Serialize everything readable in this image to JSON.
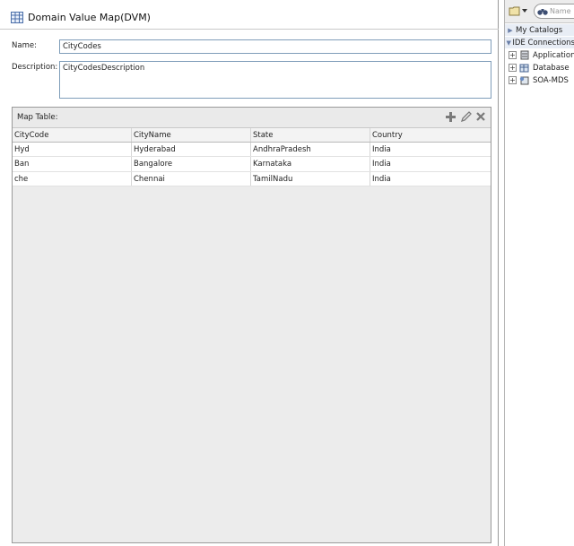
{
  "editor": {
    "title": "Domain Value Map(DVM)",
    "name_label": "Name:",
    "name_value": "CityCodes",
    "description_label": "Description:",
    "description_value": "CityCodesDescription",
    "map_table_label": "Map Table:",
    "columns": [
      "CityCode",
      "CityName",
      "State",
      "Country"
    ],
    "rows": [
      [
        "Hyd",
        "Hyderabad",
        "AndhraPradesh",
        "India"
      ],
      [
        "Ban",
        "Bangalore",
        "Karnataka",
        "India"
      ],
      [
        "che",
        "Chennai",
        "TamilNadu",
        "India"
      ]
    ]
  },
  "resource_panel": {
    "search_placeholder": "Name",
    "sections": [
      "My Catalogs",
      "IDE Connections"
    ],
    "tree": [
      "Application",
      "Database",
      "SOA-MDS"
    ]
  }
}
